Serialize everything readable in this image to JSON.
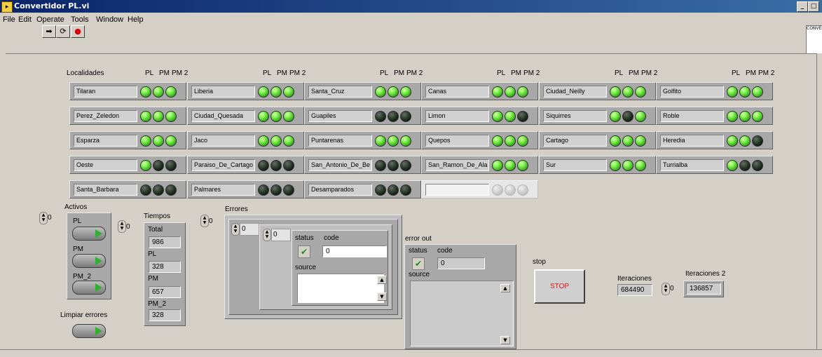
{
  "window": {
    "title": "Convertidor PL.vi",
    "min_label": "_",
    "max_label": "□",
    "close_label": "×",
    "icon": "labview-vi-icon"
  },
  "menu": [
    "File",
    "Edit",
    "Operate",
    "Tools",
    "Window",
    "Help"
  ],
  "toolbar": {
    "run": "➡",
    "run_continuous": "⟳",
    "abort": "●",
    "logo_text": "CONVERT"
  },
  "headers": {
    "localidades": "Localidades",
    "pl": "PL",
    "pm": "PM",
    "pm2": "PM 2"
  },
  "locations": [
    {
      "name": "Tilaran",
      "leds": [
        1,
        1,
        1
      ]
    },
    {
      "name": "Liberia",
      "leds": [
        1,
        1,
        1
      ]
    },
    {
      "name": "Santa_Cruz",
      "leds": [
        1,
        1,
        1
      ]
    },
    {
      "name": "Canas",
      "leds": [
        1,
        1,
        1
      ]
    },
    {
      "name": "Ciudad_Neilly",
      "leds": [
        1,
        1,
        1
      ]
    },
    {
      "name": "Golfito",
      "leds": [
        1,
        1,
        1
      ]
    },
    {
      "name": "Perez_Zeledon",
      "leds": [
        1,
        1,
        1
      ]
    },
    {
      "name": "Ciudad_Quesada",
      "leds": [
        1,
        1,
        1
      ]
    },
    {
      "name": "Guapiles",
      "leds": [
        0,
        0,
        0
      ]
    },
    {
      "name": "Limon",
      "leds": [
        1,
        1,
        0
      ]
    },
    {
      "name": "Siquirres",
      "leds": [
        1,
        0,
        1
      ]
    },
    {
      "name": "Roble",
      "leds": [
        1,
        1,
        1
      ]
    },
    {
      "name": "Esparza",
      "leds": [
        1,
        1,
        1
      ]
    },
    {
      "name": "Jaco",
      "leds": [
        1,
        1,
        1
      ]
    },
    {
      "name": "Puntarenas",
      "leds": [
        1,
        1,
        1
      ]
    },
    {
      "name": "Quepos",
      "leds": [
        1,
        1,
        1
      ]
    },
    {
      "name": "Cartago",
      "leds": [
        1,
        1,
        1
      ]
    },
    {
      "name": "Heredia",
      "leds": [
        1,
        1,
        0
      ]
    },
    {
      "name": "Oeste",
      "leds": [
        1,
        0,
        0
      ]
    },
    {
      "name": "Paraiso_De_Cartago",
      "leds": [
        0,
        0,
        0
      ]
    },
    {
      "name": "San_Antonio_De_Be",
      "leds": [
        0,
        0,
        0
      ]
    },
    {
      "name": "San_Ramon_De_Ala",
      "leds": [
        1,
        1,
        1
      ]
    },
    {
      "name": "Sur",
      "leds": [
        1,
        1,
        1
      ]
    },
    {
      "name": "Turrialba",
      "leds": [
        1,
        0,
        0
      ]
    },
    {
      "name": "Santa_Barbara",
      "leds": [
        0,
        0,
        0
      ]
    },
    {
      "name": "Palmares",
      "leds": [
        0,
        0,
        0
      ]
    },
    {
      "name": "Desamparados",
      "leds": [
        0,
        0,
        0
      ]
    },
    {
      "name": "",
      "leds": [
        2,
        2,
        2
      ]
    }
  ],
  "activos": {
    "label": "Activos",
    "index": "0",
    "pl": "PL",
    "pm": "PM",
    "pm2": "PM_2"
  },
  "limpiar": {
    "label": "Limpiar errores"
  },
  "tiempos": {
    "label": "Tiempos",
    "index": "0",
    "total_label": "Total",
    "total": "986",
    "pl_label": "PL",
    "pl": "328",
    "pm_label": "PM",
    "pm": "657",
    "pm2_label": "PM_2",
    "pm2": "328"
  },
  "errores": {
    "label": "Errores",
    "index_outer": "0",
    "index_mid": "0",
    "index_inner": "0",
    "status_label": "status",
    "code_label": "code",
    "code": "0",
    "source_label": "source",
    "status_icon": "check-icon"
  },
  "error_out": {
    "label": "error out",
    "status_label": "status",
    "code_label": "code",
    "code": "0",
    "source_label": "source"
  },
  "stop": {
    "label": "stop",
    "button": "STOP"
  },
  "iteraciones": {
    "label": "Iteraciones",
    "value": "684490"
  },
  "iteraciones2": {
    "label": "Iteraciones 2",
    "index": "0",
    "value": "136857"
  },
  "colors": {
    "led_on": "#5ee03a",
    "led_off": "#1d2b1d",
    "stop": "#e11414"
  }
}
